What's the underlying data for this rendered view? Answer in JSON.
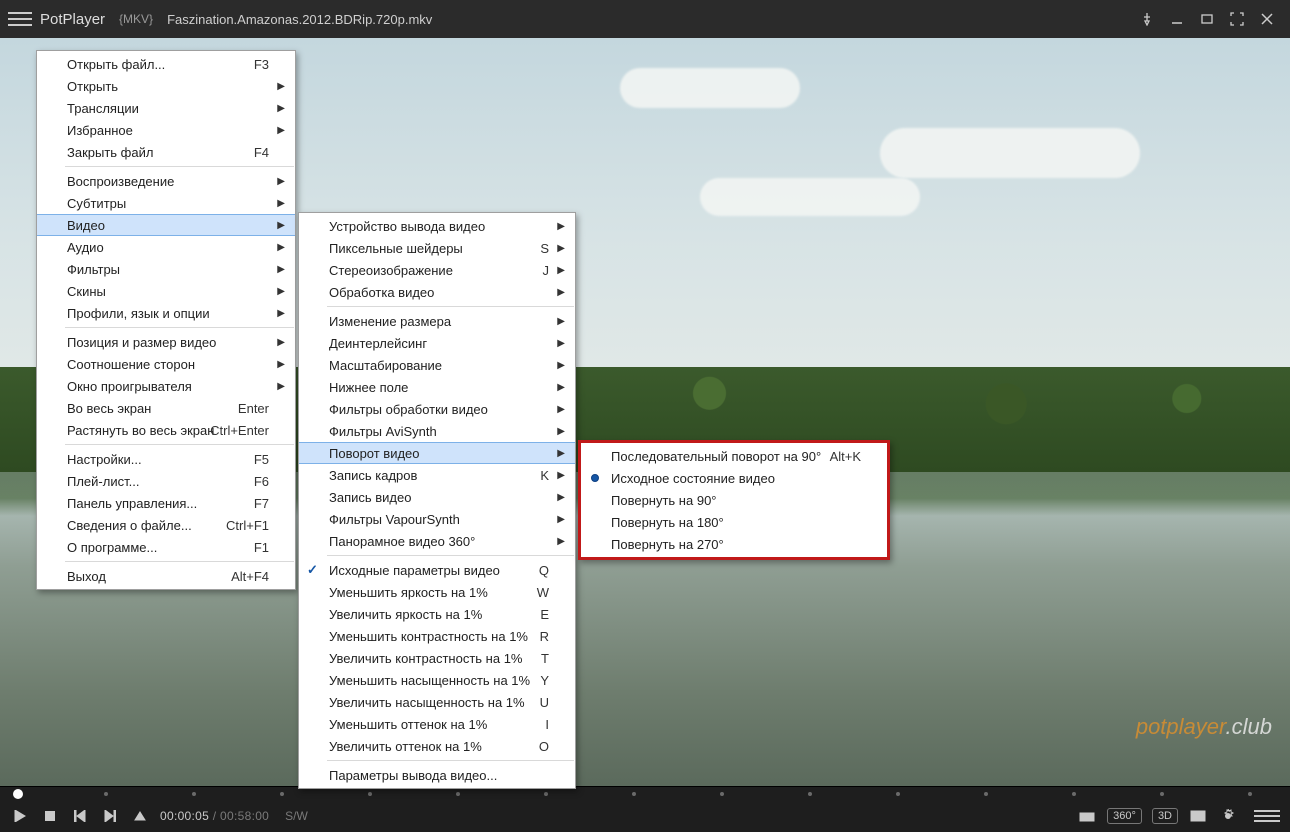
{
  "title": {
    "app": "PotPlayer",
    "format": "{MKV}",
    "file": "Faszination.Amazonas.2012.BDRip.720p.mkv"
  },
  "watermark": {
    "orange": "potplayer",
    "rest": ".club"
  },
  "controls": {
    "cur": "00:00:05",
    "dur": "00:58:00",
    "ratio": "S/W",
    "deg": "360°",
    "d3": "3D"
  },
  "menu1": {
    "g1": [
      {
        "label": "Открыть файл...",
        "sc": "F3"
      },
      {
        "label": "Открыть",
        "sub": true
      },
      {
        "label": "Трансляции",
        "sub": true
      },
      {
        "label": "Избранное",
        "sub": true
      },
      {
        "label": "Закрыть файл",
        "sc": "F4"
      }
    ],
    "g2": [
      {
        "label": "Воспроизведение",
        "sub": true
      },
      {
        "label": "Субтитры",
        "sub": true
      },
      {
        "label": "Видео",
        "sub": true,
        "hi": true
      },
      {
        "label": "Аудио",
        "sub": true
      },
      {
        "label": "Фильтры",
        "sub": true
      },
      {
        "label": "Скины",
        "sub": true
      },
      {
        "label": "Профили, язык и опции",
        "sub": true
      }
    ],
    "g3": [
      {
        "label": "Позиция и размер видео",
        "sub": true
      },
      {
        "label": "Соотношение сторон",
        "sub": true
      },
      {
        "label": "Окно проигрывателя",
        "sub": true
      },
      {
        "label": "Во весь экран",
        "sc": "Enter"
      },
      {
        "label": "Растянуть во весь экран",
        "sc": "Ctrl+Enter"
      }
    ],
    "g4": [
      {
        "label": "Настройки...",
        "sc": "F5"
      },
      {
        "label": "Плей-лист...",
        "sc": "F6"
      },
      {
        "label": "Панель управления...",
        "sc": "F7"
      },
      {
        "label": "Сведения о файле...",
        "sc": "Ctrl+F1"
      },
      {
        "label": "О программе...",
        "sc": "F1"
      }
    ],
    "g5": [
      {
        "label": "Выход",
        "sc": "Alt+F4"
      }
    ]
  },
  "menu2": {
    "g1": [
      {
        "label": "Устройство вывода видео",
        "sub": true
      },
      {
        "label": "Пиксельные шейдеры",
        "sc": "S",
        "sub": true
      },
      {
        "label": "Стереоизображение",
        "sc": "J",
        "sub": true
      },
      {
        "label": "Обработка видео",
        "sub": true
      }
    ],
    "g2": [
      {
        "label": "Изменение размера",
        "sub": true
      },
      {
        "label": "Деинтерлейсинг",
        "sub": true
      },
      {
        "label": "Масштабирование",
        "sub": true
      },
      {
        "label": "Нижнее поле",
        "sub": true
      },
      {
        "label": "Фильтры обработки видео",
        "sub": true
      },
      {
        "label": "Фильтры AviSynth",
        "sub": true
      },
      {
        "label": "Поворот видео",
        "sub": true,
        "hi": true
      },
      {
        "label": "Запись кадров",
        "sc": "K",
        "sub": true
      },
      {
        "label": "Запись видео",
        "sub": true
      },
      {
        "label": "Фильтры VapourSynth",
        "sub": true
      },
      {
        "label": "Панорамное видео 360°",
        "sub": true
      }
    ],
    "g3": [
      {
        "label": "Исходные параметры видео",
        "sc": "Q",
        "check": true
      },
      {
        "label": "Уменьшить яркость на 1%",
        "sc": "W"
      },
      {
        "label": "Увеличить яркость на 1%",
        "sc": "E"
      },
      {
        "label": "Уменьшить контрастность на 1%",
        "sc": "R"
      },
      {
        "label": "Увеличить контрастность на 1%",
        "sc": "T"
      },
      {
        "label": "Уменьшить насыщенность на 1%",
        "sc": "Y"
      },
      {
        "label": "Увеличить насыщенность на 1%",
        "sc": "U"
      },
      {
        "label": "Уменьшить оттенок на 1%",
        "sc": "I"
      },
      {
        "label": "Увеличить оттенок на 1%",
        "sc": "O"
      }
    ],
    "g4": [
      {
        "label": "Параметры вывода видео..."
      }
    ]
  },
  "menu3": {
    "items": [
      {
        "label": "Последовательный поворот на 90°",
        "sc": "Alt+K"
      },
      {
        "label": "Исходное состояние видео",
        "radio": true
      },
      {
        "label": "Повернуть на 90°"
      },
      {
        "label": "Повернуть на 180°"
      },
      {
        "label": "Повернуть на 270°"
      }
    ]
  }
}
